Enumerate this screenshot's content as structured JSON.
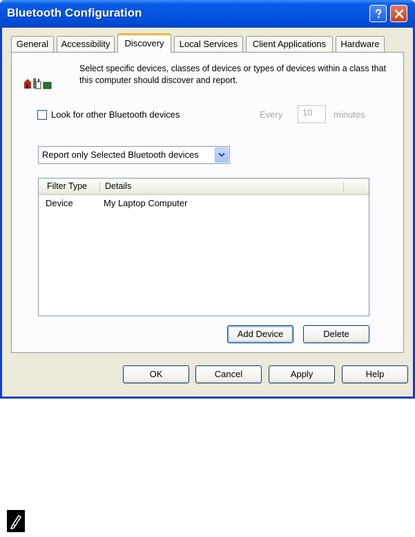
{
  "window": {
    "title": "Bluetooth Configuration"
  },
  "titlebar": {
    "help_icon": "question-mark-icon",
    "close_icon": "close-x-icon"
  },
  "tabs": [
    {
      "label": "General"
    },
    {
      "label": "Accessibility"
    },
    {
      "label": "Discovery",
      "active": true
    },
    {
      "label": "Local Services"
    },
    {
      "label": "Client Applications"
    },
    {
      "label": "Hardware"
    }
  ],
  "discovery": {
    "description": "Select specific devices, classes of devices or types of devices within a class that this computer should discover and report.",
    "look_for_label": "Look for other Bluetooth devices",
    "look_for_checked": false,
    "every_label": "Every",
    "interval_value": "10",
    "minutes_label": "minutes",
    "report_mode": "Report only Selected Bluetooth devices",
    "list": {
      "columns": [
        "Filter Type",
        "Details"
      ],
      "rows": [
        {
          "filter_type": "Device",
          "details": "My Laptop Computer"
        }
      ]
    },
    "add_device_label": "Add Device",
    "delete_label": "Delete"
  },
  "footer": {
    "ok_label": "OK",
    "cancel_label": "Cancel",
    "apply_label": "Apply",
    "help_label": "Help"
  },
  "note_icon": "pencil-note-icon"
}
